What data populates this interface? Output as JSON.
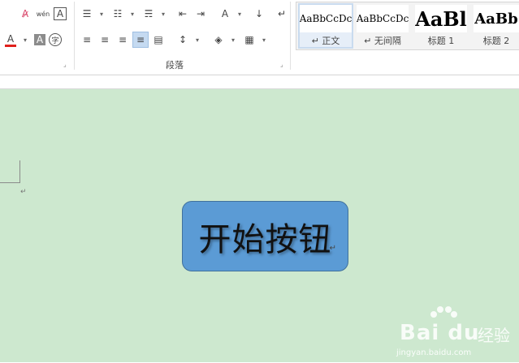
{
  "ribbon": {
    "font_row1_icons": [
      "clear-format-icon",
      "phonetic-guide-icon",
      "character-border-icon"
    ],
    "font_row1_glyphs": [
      "A̷",
      "wén",
      "A"
    ],
    "font_row2_icons": [
      "font-color-icon",
      "highlight-icon",
      "character-shading-icon",
      "enclose-character-icon"
    ],
    "font_row2_glyphs": [
      "A",
      "A",
      "A",
      "字"
    ],
    "paragraph_group_label": "段落",
    "paragraph_row1_glyphs": [
      "☰",
      "☷",
      "☴",
      "⇤",
      "⇥",
      "A",
      "↓",
      "↵"
    ],
    "paragraph_row2_glyphs": [
      "≡",
      "≡",
      "≡",
      "≡",
      "▤",
      "↕",
      "◈",
      "▦"
    ],
    "accent_color": "#5b9bd5",
    "font_color_swatch": "#e0201b"
  },
  "styles": {
    "items": [
      {
        "preview": "AaBbCcDc",
        "label": "↵ 正文",
        "active": true
      },
      {
        "preview": "AaBbCcDc",
        "label": "↵ 无间隔",
        "active": false
      },
      {
        "preview": "AaBl",
        "label": "标题 1",
        "active": false
      },
      {
        "preview": "AaBb",
        "label": "标题 2",
        "active": false
      }
    ]
  },
  "document": {
    "background": "#cde8cf",
    "paragraph_mark": "↵",
    "shape_text": "开始按钮",
    "shape_paragraph_mark": "↵",
    "shape_fill": "#5b9bd5"
  },
  "watermark": {
    "logo_text": "Bai du",
    "cn_text": "经验",
    "url": "jingyan.baidu.com"
  }
}
